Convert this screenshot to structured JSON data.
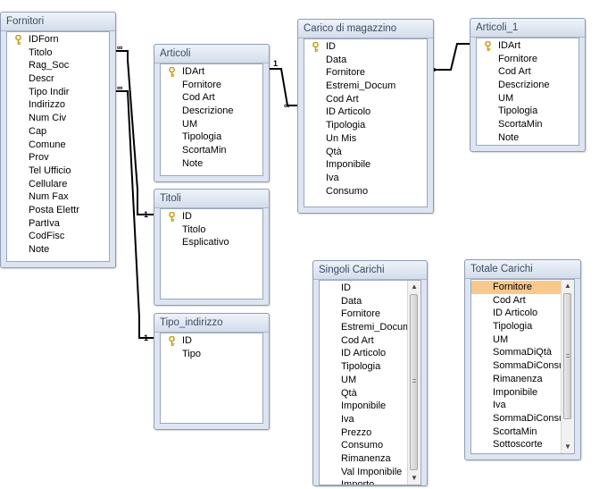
{
  "tables": {
    "fornitori": {
      "title": "Fornitori",
      "fields": [
        "IDForn",
        "Titolo",
        "Rag_Soc",
        "Descr",
        "Tipo Indir",
        "Indirizzo",
        "Num Civ",
        "Cap",
        "Comune",
        "Prov",
        "Tel Ufficio",
        "Cellulare",
        "Num Fax",
        "Posta Elettr",
        "PartIva",
        "CodFisc",
        "Note"
      ]
    },
    "articoli": {
      "title": "Articoli",
      "fields": [
        "IDArt",
        "Fornitore",
        "Cod Art",
        "Descrizione",
        "UM",
        "Tipologia",
        "ScortaMin",
        "Note"
      ]
    },
    "carico": {
      "title": "Carico di magazzino",
      "fields": [
        "ID",
        "Data",
        "Fornitore",
        "Estremi_Docum",
        "Cod Art",
        "ID Articolo",
        "Tipologia",
        "Un Mis",
        "Qtà",
        "Imponibile",
        "Iva",
        "Consumo"
      ]
    },
    "articoli1": {
      "title": "Articoli_1",
      "fields": [
        "IDArt",
        "Fornitore",
        "Cod Art",
        "Descrizione",
        "UM",
        "Tipologia",
        "ScortaMin",
        "Note"
      ]
    },
    "titoli": {
      "title": "Titoli",
      "fields": [
        "ID",
        "Titolo",
        "Esplicativo"
      ]
    },
    "tipoind": {
      "title": "Tipo_indirizzo",
      "fields": [
        "ID",
        "Tipo"
      ]
    },
    "singoli": {
      "title": "Singoli Carichi",
      "fields": [
        "ID",
        "Data",
        "Fornitore",
        "Estremi_Docum",
        "Cod Art",
        "ID Articolo",
        "Tipologia",
        "UM",
        "Qtà",
        "Imponibile",
        "Iva",
        "Prezzo",
        "Consumo",
        "Rimanenza",
        "Val Imponibile",
        "Importo"
      ]
    },
    "totale": {
      "title": "Totale Carichi",
      "fields": [
        "Fornitore",
        "Cod Art",
        "ID Articolo",
        "Tipologia",
        "UM",
        "SommaDiQtà",
        "SommaDiConsu",
        "Rimanenza",
        "Imponibile",
        "Iva",
        "SommaDiConsu",
        "ScortaMin",
        "Sottoscorte"
      ]
    }
  },
  "relations": {
    "one": "1",
    "many": "∞"
  },
  "colors": {
    "title_bg": "#dce5f1",
    "title_text": "#3a4c66",
    "selection": "#f9c88c",
    "key": "#c8a020"
  }
}
